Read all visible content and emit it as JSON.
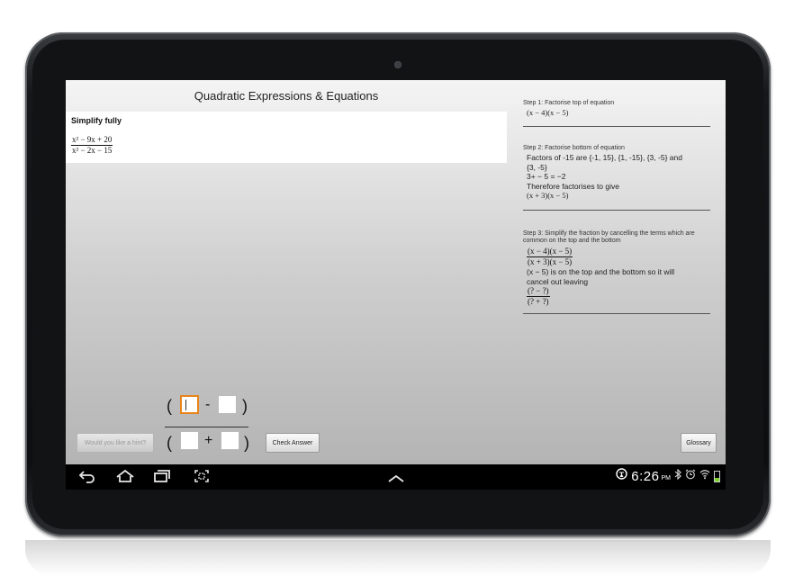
{
  "app": {
    "title": "Quadratic Expressions & Equations",
    "question": {
      "label": "Simplify fully",
      "numerator": "x² − 9x + 20",
      "denominator": "x² − 2x − 15"
    },
    "steps": [
      {
        "title": "Step 1: Factorise top of equation",
        "lines": [
          "(x − 4)(x − 5)"
        ]
      },
      {
        "title": "Step 2: Factorise bottom of equation",
        "lines": [
          "Factors of -15 are {-1, 15}, {1, -15}, {3, -5} and",
          "{3, -5}",
          "3+ − 5 = −2",
          "Therefore factorises to give",
          "(x + 3)(x − 5)"
        ]
      },
      {
        "title": "Step 3: Simplify the fraction by cancelling the terms which are common on the top and the bottom",
        "fraction1_num": "(x − 4)(x − 5)",
        "fraction1_den": "(x + 3)(x − 5)",
        "lines": [
          "(x − 5) is on the top and the bottom so it will",
          "cancel out leaving"
        ],
        "fraction2_num": "(? − ?)",
        "fraction2_den": "(? + ?)"
      }
    ],
    "answer": {
      "top_open": "(",
      "top_op": "-",
      "top_close": ")",
      "bottom_open": "(",
      "bottom_op": "+",
      "bottom_close": ")"
    },
    "buttons": {
      "hint": "Would you like a hint?",
      "check": "Check Answer",
      "glossary": "Glossary"
    }
  },
  "status_bar": {
    "time": "6:26",
    "ampm": "PM"
  },
  "icons": {
    "back": "back-icon",
    "home": "home-icon",
    "recent": "recent-apps-icon",
    "screenshot": "screenshot-icon",
    "up": "chevron-up-icon",
    "accessibility": "accessibility-icon",
    "bluetooth": "bluetooth-icon",
    "alarm": "alarm-icon",
    "wifi": "wifi-icon",
    "battery": "battery-icon"
  },
  "colors": {
    "active_input_border": "#e8841a",
    "battery_fill": "#7cd12c"
  }
}
